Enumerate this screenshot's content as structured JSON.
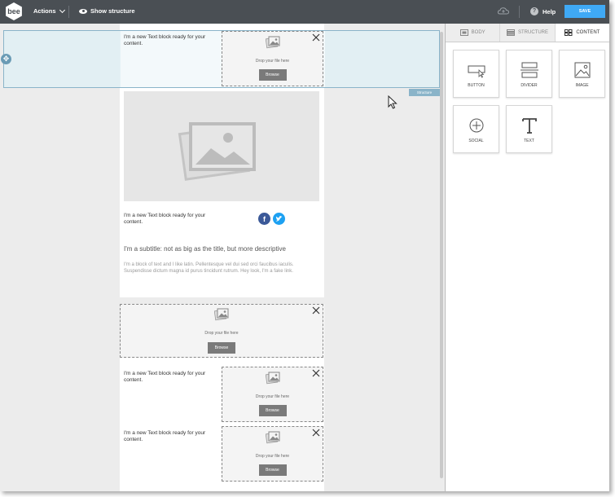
{
  "topbar": {
    "logo_text": "bee",
    "actions_label": "Actions",
    "show_structure_label": "Show structure",
    "help_label": "Help",
    "save_label": "SAVE"
  },
  "panel": {
    "tabs": [
      {
        "label": "BODY",
        "icon": "body-icon",
        "active": false
      },
      {
        "label": "STRUCTURE",
        "icon": "structure-icon",
        "active": false
      },
      {
        "label": "CONTENT",
        "icon": "content-grid-icon",
        "active": true
      }
    ],
    "tiles": [
      {
        "label": "BUTTON",
        "icon": "button-icon"
      },
      {
        "label": "DIVIDER",
        "icon": "divider-icon"
      },
      {
        "label": "IMAGE",
        "icon": "image-icon"
      },
      {
        "label": "SOCIAL",
        "icon": "social-icon"
      },
      {
        "label": "TEXT",
        "icon": "text-icon"
      }
    ]
  },
  "canvas": {
    "structure_tag": "Structure",
    "text_block": "I'm a new Text block ready for your content.",
    "dropzone": {
      "drop_text": "Drop your file here",
      "browse_label": "Browse"
    },
    "subtitle": "I'm a subtitle: not as big as the title, but more descriptive",
    "paragraph": "I'm a block of text and I like latin. Pellentesque vel dui sed orci faucibus iaculis. Suspendisse dictum magna id purus tincidunt rutrum. Hey look, I'm a fake link.",
    "social": {
      "facebook": "f"
    }
  },
  "colors": {
    "topbar": "#4a4f54",
    "save": "#3fa9f5",
    "selection": "#8ab4c9",
    "facebook": "#3b5998",
    "twitter": "#1da1f2"
  }
}
